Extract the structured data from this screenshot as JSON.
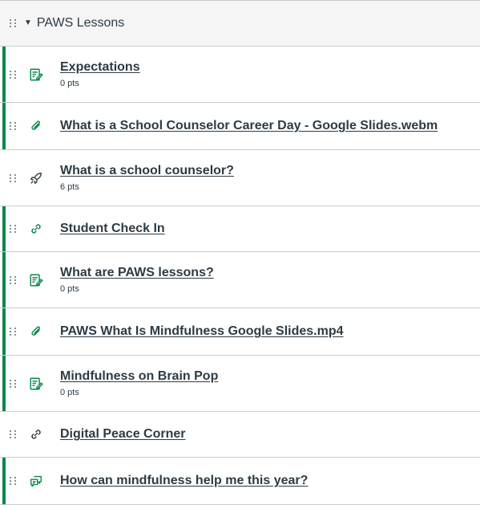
{
  "module": {
    "title": "PAWS Lessons",
    "items": [
      {
        "title": "Expectations",
        "points": "0 pts",
        "icon": "assignment-icon",
        "published": true
      },
      {
        "title": "What is a School Counselor Career Day - Google Slides.webm",
        "points": "",
        "icon": "attachment-icon",
        "published": true
      },
      {
        "title": "What is a school counselor?",
        "points": "6 pts",
        "icon": "quiz-rocket-icon",
        "published": false
      },
      {
        "title": "Student Check In",
        "points": "",
        "icon": "link-icon",
        "published": true
      },
      {
        "title": "What are PAWS lessons?",
        "points": "0 pts",
        "icon": "assignment-icon",
        "published": true
      },
      {
        "title": "PAWS What Is Mindfulness Google Slides.mp4",
        "points": "",
        "icon": "attachment-icon",
        "published": true
      },
      {
        "title": "Mindfulness on Brain Pop",
        "points": "0 pts",
        "icon": "assignment-icon",
        "published": true
      },
      {
        "title": "Digital Peace Corner",
        "points": "",
        "icon": "link-icon",
        "published": false
      },
      {
        "title": "How can mindfulness help me this year?",
        "points": "",
        "icon": "discussion-icon",
        "published": true
      }
    ]
  },
  "colors": {
    "published": "#0b874b",
    "unpublished_icon": "#2d3b45",
    "text": "#2d3b45"
  }
}
